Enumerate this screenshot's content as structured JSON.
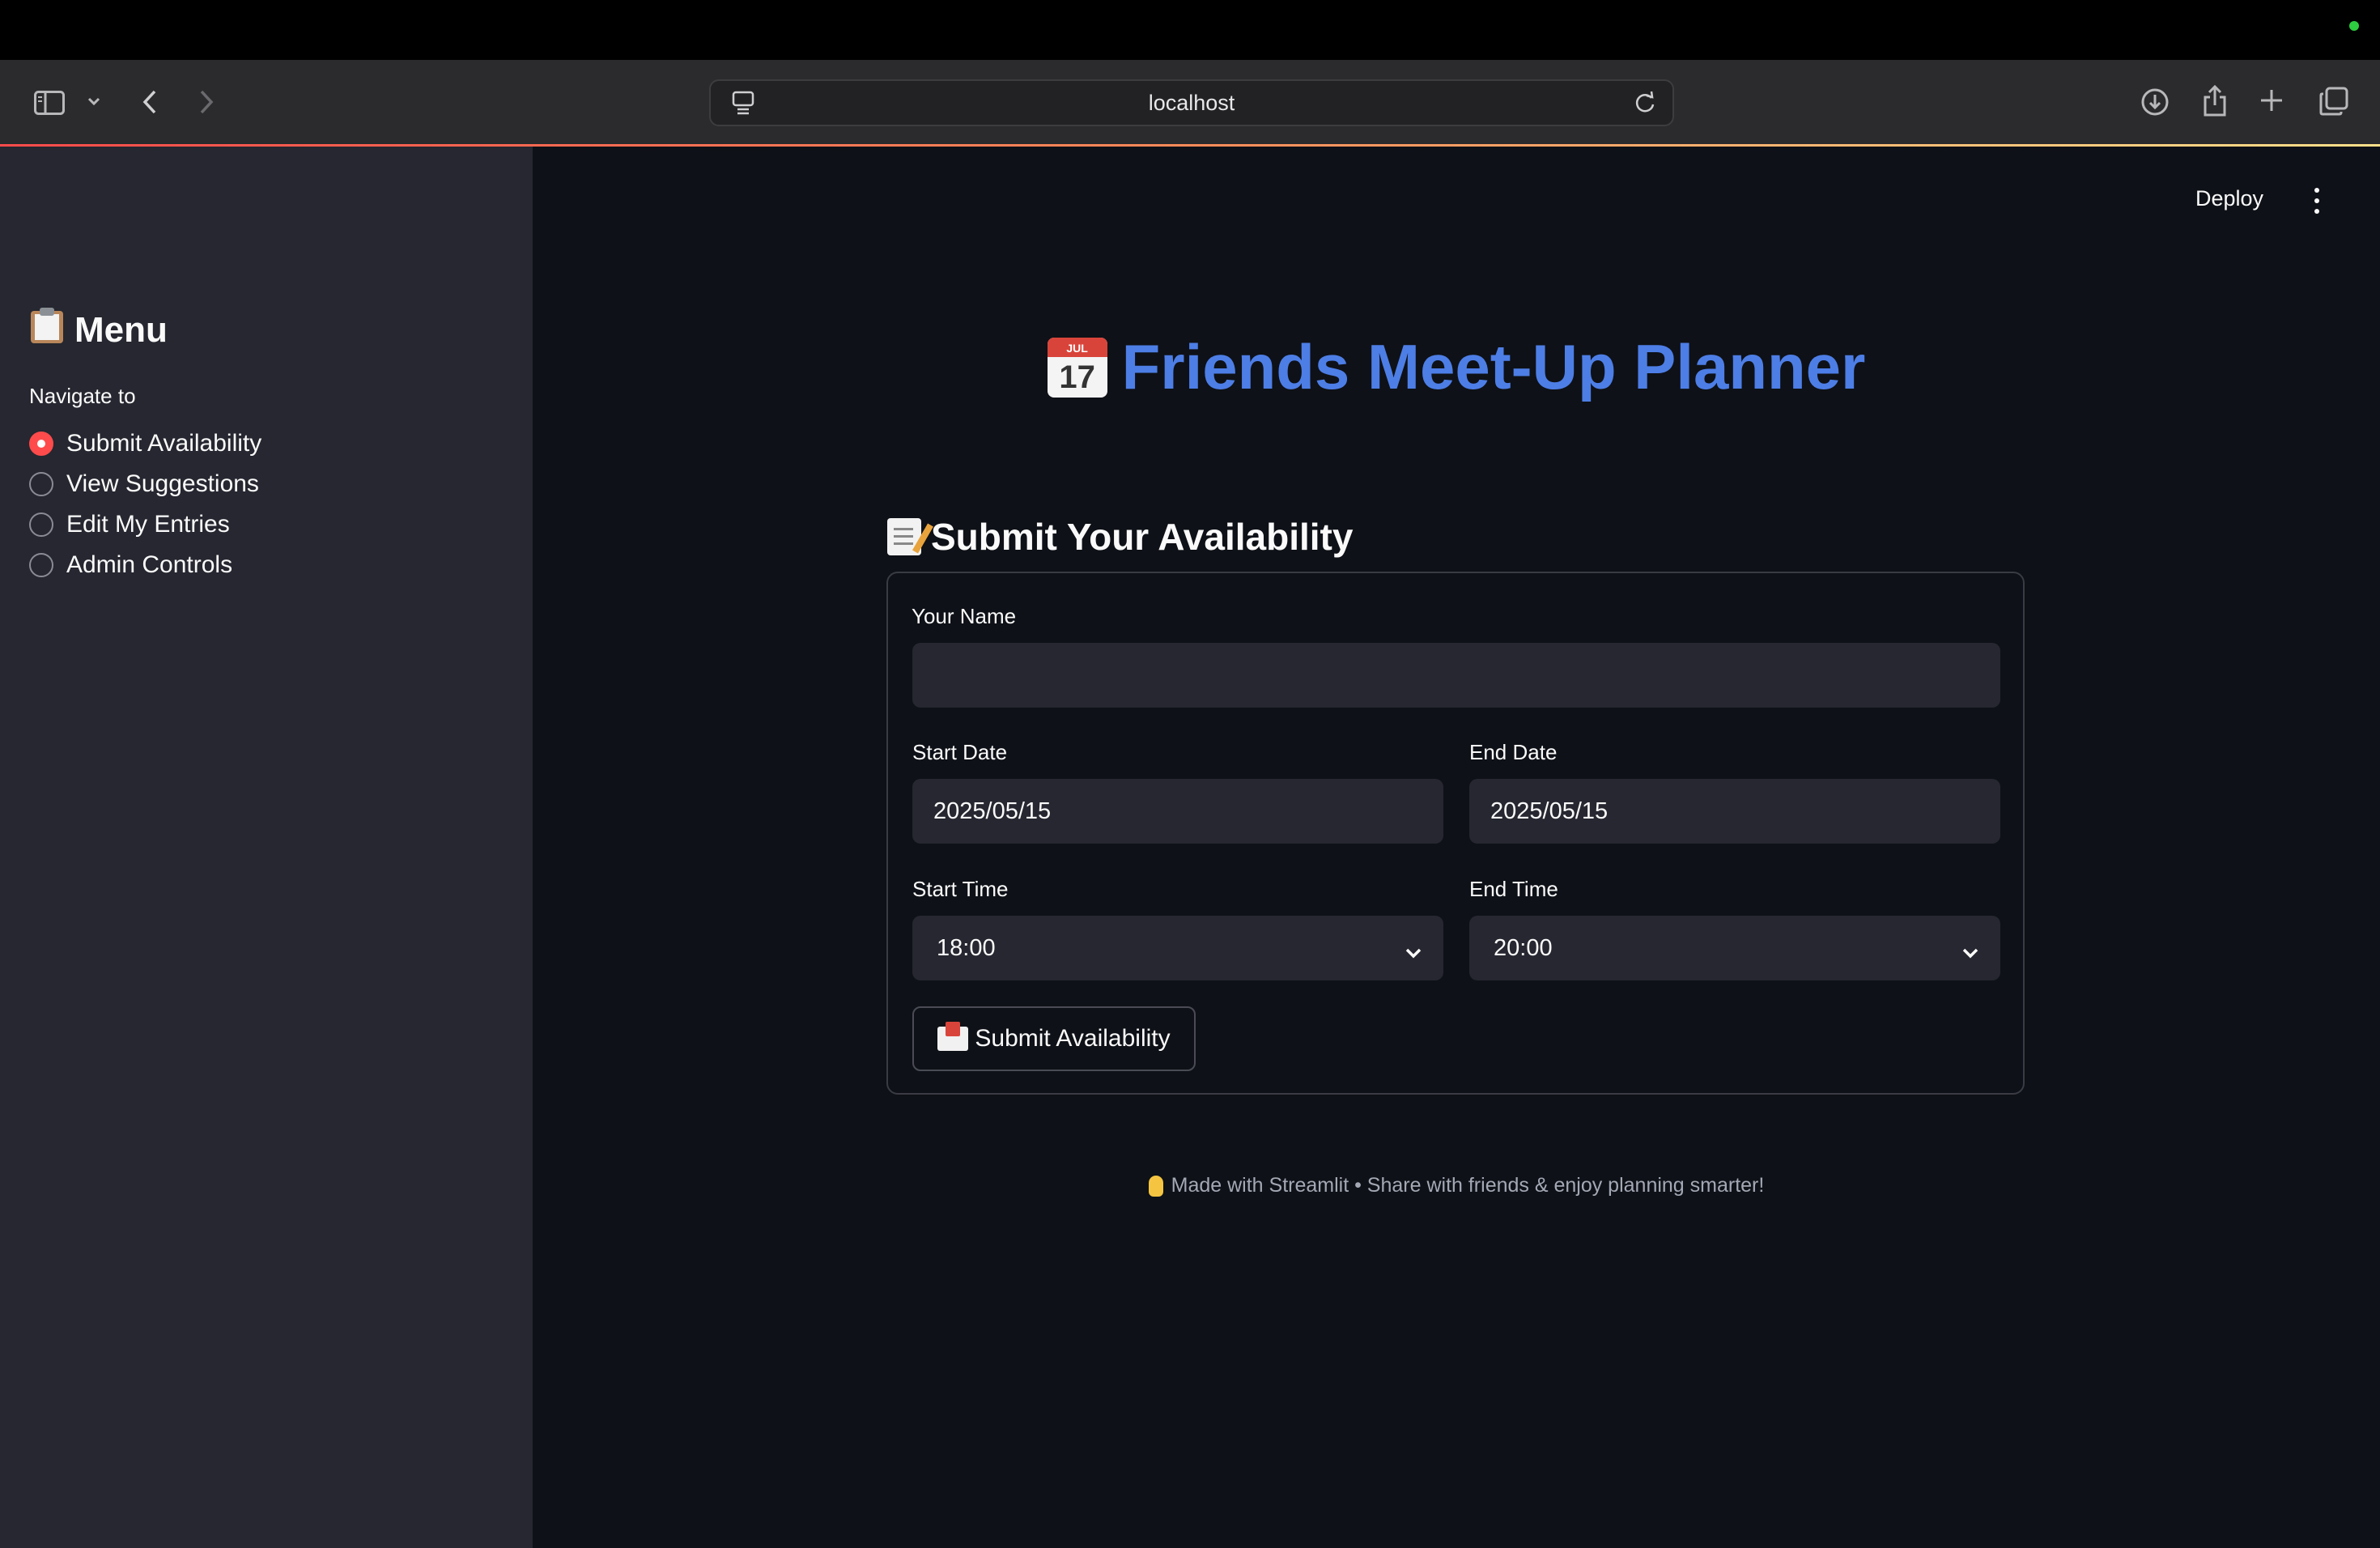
{
  "browser": {
    "url": "localhost"
  },
  "sidebar": {
    "title": "Menu",
    "nav_label": "Navigate to",
    "items": [
      {
        "label": "Submit Availability",
        "selected": true
      },
      {
        "label": "View Suggestions",
        "selected": false
      },
      {
        "label": "Edit My Entries",
        "selected": false
      },
      {
        "label": "Admin Controls",
        "selected": false
      }
    ]
  },
  "header": {
    "deploy_label": "Deploy"
  },
  "main": {
    "title": "Friends Meet-Up Planner",
    "calendar_icon": {
      "month": "JUL",
      "day": "17"
    },
    "section_title": "Submit Your Availability",
    "form": {
      "name_label": "Your Name",
      "name_value": "",
      "start_date_label": "Start Date",
      "start_date_value": "2025/05/15",
      "end_date_label": "End Date",
      "end_date_value": "2025/05/15",
      "start_time_label": "Start Time",
      "start_time_value": "18:00",
      "end_time_label": "End Time",
      "end_time_value": "20:00",
      "submit_label": "Submit Availability"
    },
    "footer": "Made with Streamlit • Share with friends & enjoy planning smarter!"
  },
  "colors": {
    "accent": "#ff4b4b",
    "title_blue": "#4d7ee6",
    "background": "#0e1117",
    "sidebar": "#262730"
  }
}
